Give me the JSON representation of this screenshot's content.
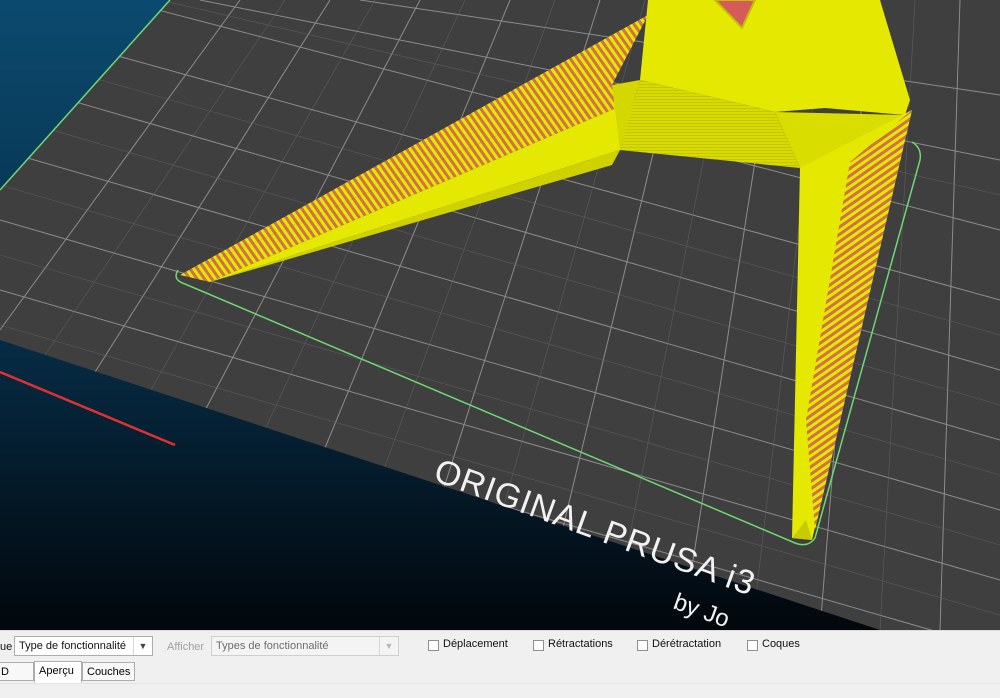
{
  "viewport": {
    "bed_logo_line1": "ORIGINAL PRUSA i3",
    "bed_logo_line2": "by Jo",
    "colors": {
      "background_top": "#0b4a6e",
      "background_bottom": "#02070c",
      "bed": "#3f3f3f",
      "grid": "#9a9a9a",
      "model_yellow": "#e5e800",
      "model_infill": "#d2704a",
      "skirt_green": "#6fd874",
      "x_axis": "#e03030"
    }
  },
  "toolbar": {
    "view_label_partial": "ue",
    "view_select_value": "Type de fonctionnalité",
    "show_label": "Afficher",
    "show_select_value": "Types de fonctionnalité",
    "options": [
      {
        "label": "Déplacement",
        "checked": false
      },
      {
        "label": "Rétractations",
        "checked": false
      },
      {
        "label": "Dérétractation",
        "checked": false
      },
      {
        "label": "Coques",
        "checked": false
      }
    ]
  },
  "tabs": {
    "partial_tab": "D",
    "items": [
      {
        "label": "Aperçu",
        "active": true
      },
      {
        "label": "Couches",
        "active": false
      }
    ]
  }
}
